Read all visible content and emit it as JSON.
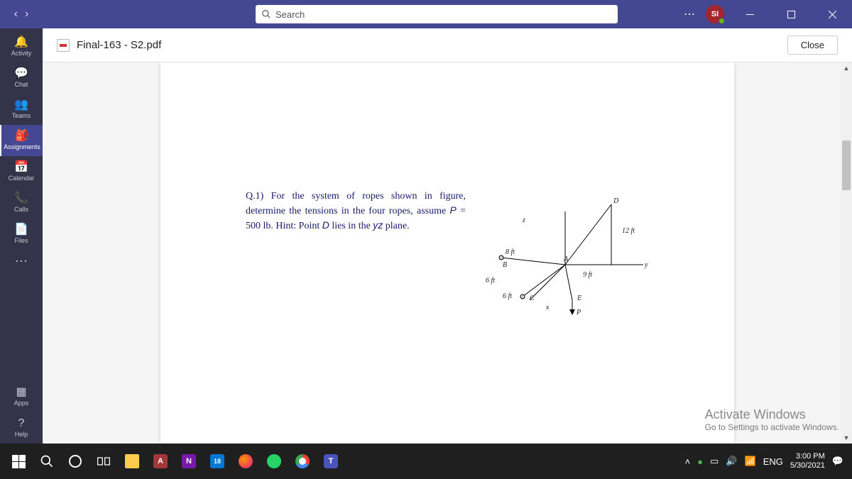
{
  "title_bar": {
    "search_placeholder": "Search",
    "avatar_initials": "SI"
  },
  "rail": {
    "items": [
      {
        "label": "Activity"
      },
      {
        "label": "Chat"
      },
      {
        "label": "Teams"
      },
      {
        "label": "Assignments"
      },
      {
        "label": "Calendar"
      },
      {
        "label": "Calls"
      },
      {
        "label": "Files"
      }
    ],
    "bottom": [
      {
        "label": "Apps"
      },
      {
        "label": "Help"
      }
    ]
  },
  "doc": {
    "filename": "Final-163 - S2.pdf",
    "close_label": "Close",
    "question_html": "Q.1) For the system of ropes shown in figure, determine the tensions in the four ropes, assume P = 500 lb. Hint: Point D lies in the yz plane.",
    "diagram_labels": {
      "d12": "12 ft",
      "d8": "8 ft",
      "d9": "9 ft",
      "d6a": "6 ft",
      "d6b": "6 ft",
      "A": "A",
      "B": "B",
      "C": "C",
      "D": "D",
      "E": "E",
      "P": "P",
      "x": "x",
      "y": "y",
      "z": "z"
    }
  },
  "watermark": {
    "line1": "Activate Windows",
    "line2": "Go to Settings to activate Windows."
  },
  "taskbar": {
    "lang": "ENG",
    "time": "3:00 PM",
    "date": "5/30/2021"
  }
}
